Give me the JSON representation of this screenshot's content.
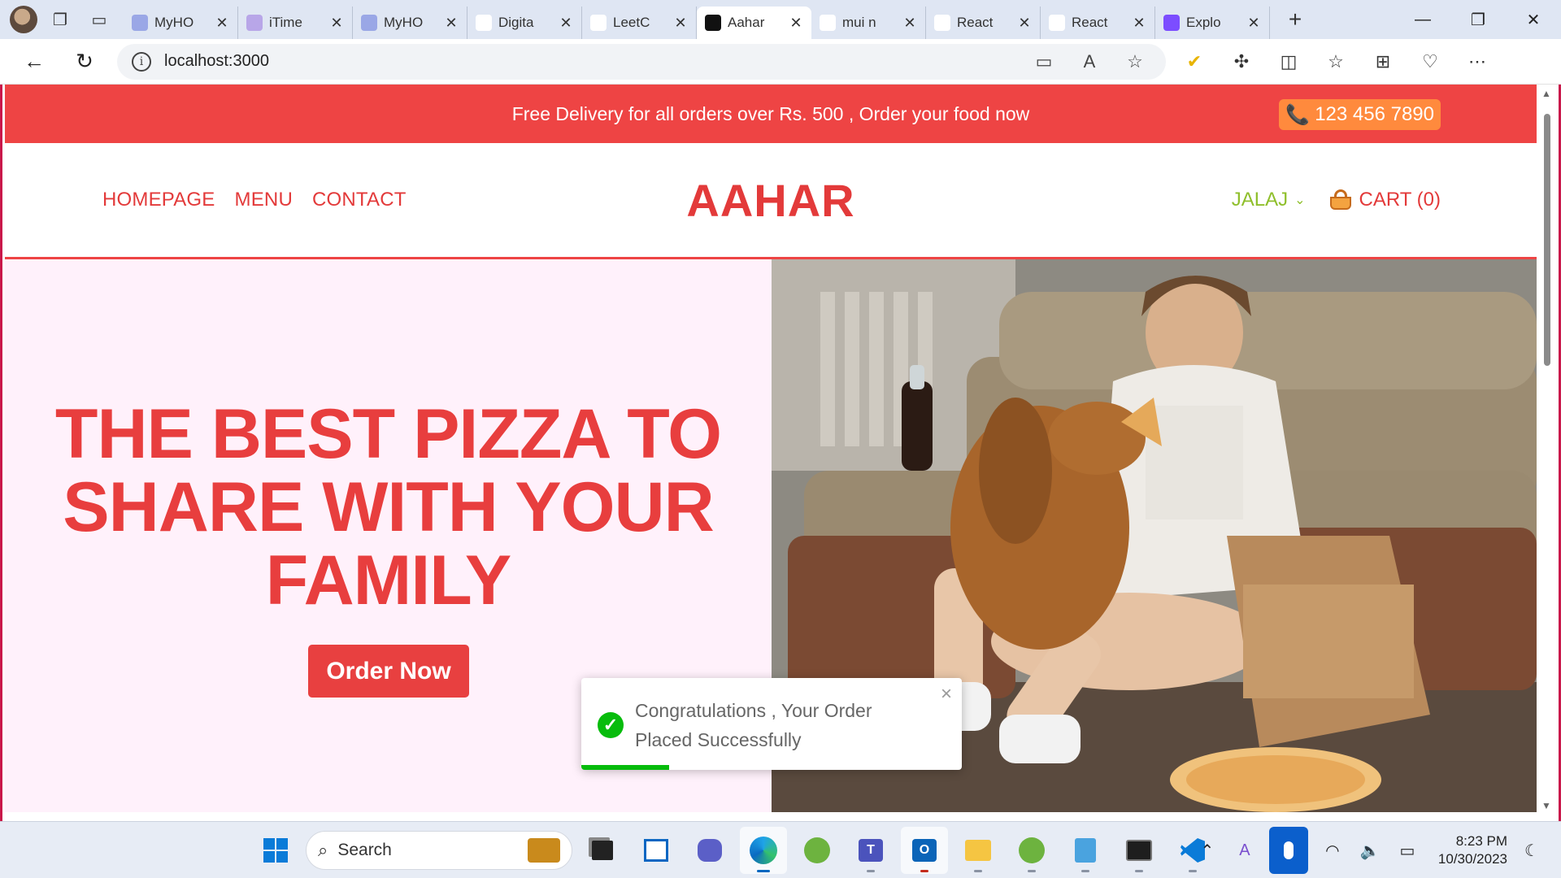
{
  "browser": {
    "tabs": [
      {
        "title": "MyHO",
        "icon": "myho-icon"
      },
      {
        "title": "iTime",
        "icon": "clock-icon"
      },
      {
        "title": "MyHO",
        "icon": "myho-icon"
      },
      {
        "title": "Digita",
        "icon": "digital-icon"
      },
      {
        "title": "LeetC",
        "icon": "leetcode-icon"
      },
      {
        "title": "Aahar",
        "icon": "react-app-icon"
      },
      {
        "title": "mui n",
        "icon": "search-icon"
      },
      {
        "title": "React",
        "icon": "mui-icon"
      },
      {
        "title": "React",
        "icon": "mui-icon"
      },
      {
        "title": "Explo",
        "icon": "stackblitz-icon"
      }
    ],
    "active_tab_index": 5,
    "url": "localhost:3000"
  },
  "page": {
    "promo_text": "Free Delivery for all orders over Rs. 500 , Order your food now",
    "phone": "123 456 7890",
    "nav_links": [
      "HOMEPAGE",
      "MENU",
      "CONTACT"
    ],
    "brand": "AAHAR",
    "user": "JALAJ",
    "cart": "CART (0)",
    "hero": {
      "title_lines": [
        "THE BEST PIZZA TO",
        "SHARE WITH YOUR",
        "FAMILY"
      ],
      "cta": "Order Now"
    },
    "colors": {
      "primary_red": "#ee4444",
      "phone_orange": "#ff8a3d",
      "user_green": "#8fbf2b",
      "hero_bg": "#fff1fb"
    }
  },
  "toast": {
    "line1": "Congratulations , Your Order",
    "line2": "Placed Successfully",
    "progress": 0.23,
    "type": "success"
  },
  "taskbar": {
    "search_placeholder": "Search",
    "time": "8:23 PM",
    "date": "10/30/2023"
  }
}
